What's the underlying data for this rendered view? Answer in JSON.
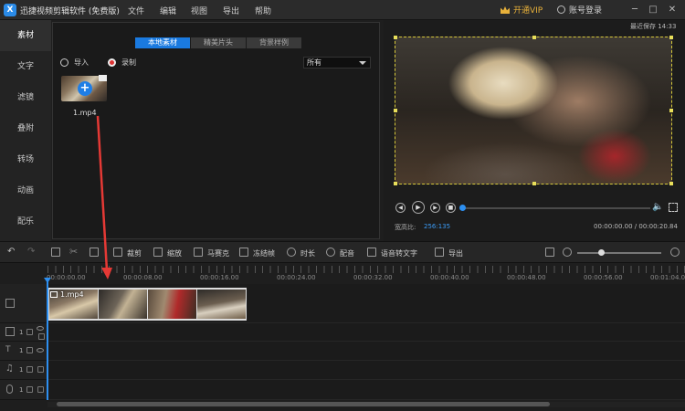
{
  "app": {
    "title": "迅捷视频剪辑软件 (免费版)",
    "logo": "X"
  },
  "menu": [
    "文件",
    "编辑",
    "视图",
    "导出",
    "帮助"
  ],
  "header": {
    "vip_label": "开通VIP",
    "login_label": "账号登录"
  },
  "window_controls": {
    "min": "─",
    "max": "□",
    "close": "✕"
  },
  "sidebar": {
    "items": [
      "素材",
      "文字",
      "滤镜",
      "叠附",
      "转场",
      "动画",
      "配乐"
    ],
    "active_index": 0
  },
  "media": {
    "tabs": [
      "本地素材",
      "精美片头",
      "背景样例"
    ],
    "active_tab": 0,
    "import_label": "导入",
    "record_label": "录制",
    "filter_value": "所有",
    "file": {
      "name": "1.mp4",
      "add_symbol": "+"
    }
  },
  "preview": {
    "autosave": "最近保存 14:33",
    "aspect_label": "宽高比:",
    "aspect_value": "256:135",
    "timecode": "00:00:00.00 / 00:00:20.84",
    "progress": 0.0
  },
  "toolbar": {
    "items": [
      "裁剪",
      "缩放",
      "马赛克",
      "冻结帧",
      "时长",
      "配音",
      "语音转文字",
      "导出"
    ]
  },
  "timeline": {
    "ticks": [
      "00:00:00.00",
      "00:00:08.00",
      "00:00:16.00",
      "00:00:24.00",
      "00:00:32.00",
      "00:00:40.00",
      "00:00:48.00",
      "00:00:56.00",
      "00:01:04.00"
    ],
    "clip_name": "1.mp4",
    "track_number": "1",
    "zoom_level": 0.28
  },
  "colors": {
    "accent": "#1a7ae0",
    "vip": "#e8b13a",
    "annotation": "#e53935"
  }
}
